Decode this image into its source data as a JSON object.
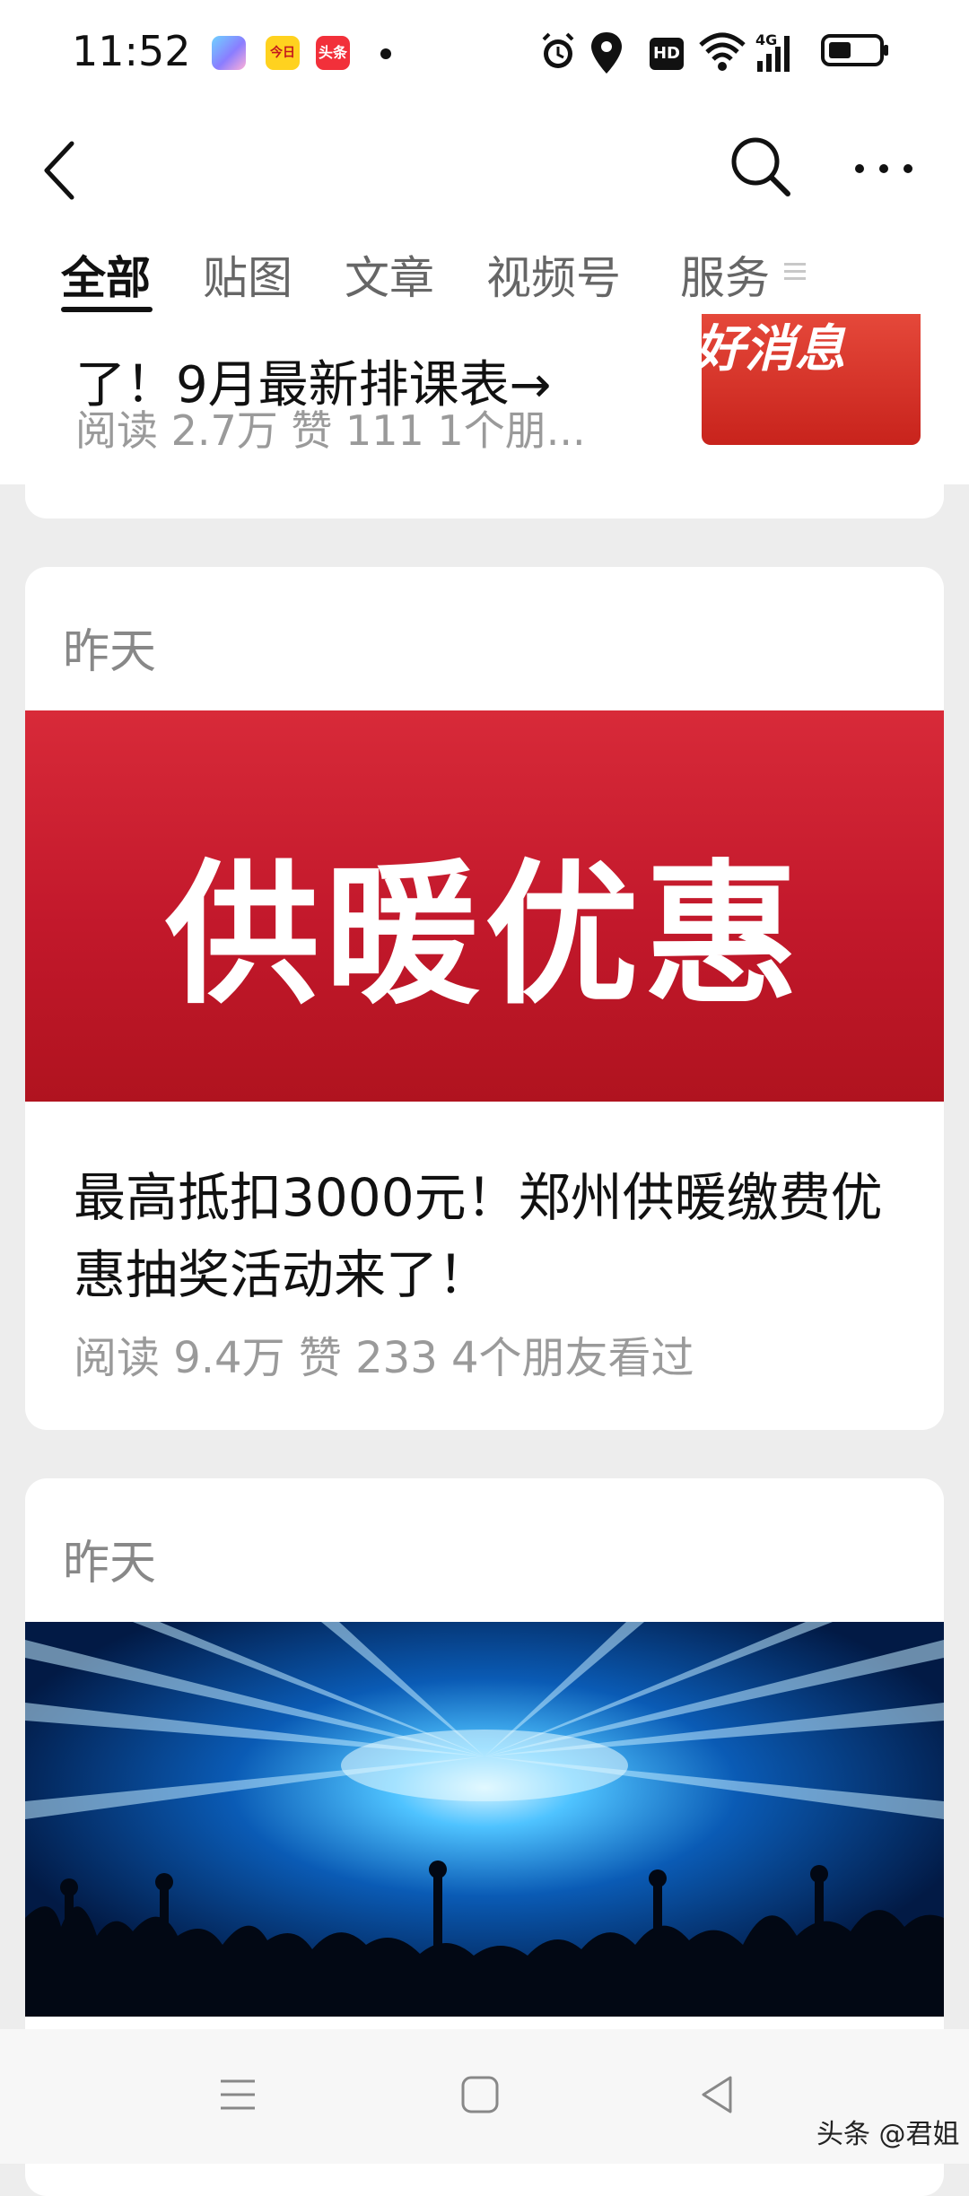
{
  "status_bar": {
    "time": "11:52",
    "apps": [
      "app-icon",
      "今日",
      "头条"
    ],
    "hd_label": "HD",
    "network": "4G"
  },
  "header": {
    "back_icon": "chevron-left-icon",
    "search_icon": "search-icon",
    "more_icon": "more-dots-icon"
  },
  "tabs": [
    {
      "label": "全部",
      "active": true
    },
    {
      "label": "贴图",
      "active": false
    },
    {
      "label": "文章",
      "active": false
    },
    {
      "label": "视频号",
      "active": false
    },
    {
      "label": "服务",
      "active": false
    }
  ],
  "articles": [
    {
      "title": "了！9月最新排课表→",
      "meta": "阅读 2.7万   赞 111   1个朋...",
      "thumb_text": "好消息"
    },
    {
      "date": "昨天",
      "banner_text": "供暖优惠",
      "title": "最高抵扣3000元！郑州供暖缴费优惠抽奖活动来了！",
      "meta": "阅读 9.4万   赞 233   4个朋友看过"
    },
    {
      "date": "昨天"
    }
  ],
  "watermark": "头条 @君姐",
  "colors": {
    "accent_red": "#c8202e",
    "text_dark": "#111111",
    "text_gray": "#9a9a9a",
    "background": "#ededed"
  }
}
